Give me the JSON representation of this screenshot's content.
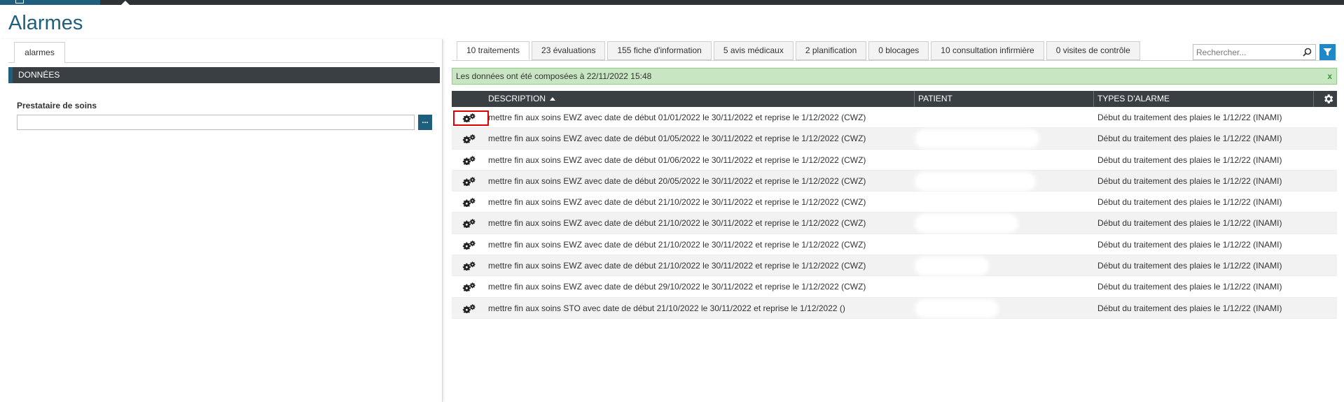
{
  "page": {
    "title": "Alarmes"
  },
  "left": {
    "tab_label": "alarmes",
    "section_title": "DONNÉES",
    "field_label": "Prestataire de soins",
    "field_value": "",
    "field_button": "..."
  },
  "tabs": [
    {
      "label": "10 traitements",
      "active": true
    },
    {
      "label": "23 évaluations",
      "active": false
    },
    {
      "label": "155 fiche d'information",
      "active": false
    },
    {
      "label": "5 avis médicaux",
      "active": false
    },
    {
      "label": "2 planification",
      "active": false
    },
    {
      "label": "0 blocages",
      "active": false
    },
    {
      "label": "10 consultation infirmière",
      "active": false
    },
    {
      "label": "0 visites de contrôle",
      "active": false
    }
  ],
  "search": {
    "placeholder": "Rechercher..."
  },
  "banner": {
    "text": "Les données ont été composées à 22/11/2022 15:48",
    "close": "x"
  },
  "grid": {
    "columns": {
      "description": "DESCRIPTION",
      "patient": "PATIENT",
      "types": "TYPES D'ALARME"
    },
    "rows": [
      {
        "description": "mettre fin aux soins EWZ avec date de début 01/01/2022 le 30/11/2022 et reprise le 1/12/2022 (CWZ)",
        "patient": "",
        "type": "Début du traitement des plaies le 1/12/22 (INAMI)"
      },
      {
        "description": "mettre fin aux soins EWZ avec date de début 01/05/2022 le 30/11/2022 et reprise le 1/12/2022 (CWZ)",
        "patient": "",
        "type": "Début du traitement des plaies le 1/12/22 (INAMI)"
      },
      {
        "description": "mettre fin aux soins EWZ avec date de début 01/06/2022 le 30/11/2022 et reprise le 1/12/2022 (CWZ)",
        "patient": "",
        "type": "Début du traitement des plaies le 1/12/22 (INAMI)"
      },
      {
        "description": "mettre fin aux soins EWZ avec date de début 20/05/2022 le 30/11/2022 et reprise le 1/12/2022 (CWZ)",
        "patient": "",
        "type": "Début du traitement des plaies le 1/12/22 (INAMI)"
      },
      {
        "description": "mettre fin aux soins EWZ avec date de début 21/10/2022 le 30/11/2022 et reprise le 1/12/2022 (CWZ)",
        "patient": "",
        "type": "Début du traitement des plaies le 1/12/22 (INAMI)"
      },
      {
        "description": "mettre fin aux soins EWZ avec date de début 21/10/2022 le 30/11/2022 et reprise le 1/12/2022 (CWZ)",
        "patient": "",
        "type": "Début du traitement des plaies le 1/12/22 (INAMI)"
      },
      {
        "description": "mettre fin aux soins EWZ avec date de début 21/10/2022 le 30/11/2022 et reprise le 1/12/2022 (CWZ)",
        "patient": "",
        "type": "Début du traitement des plaies le 1/12/22 (INAMI)"
      },
      {
        "description": "mettre fin aux soins EWZ avec date de début 21/10/2022 le 30/11/2022 et reprise le 1/12/2022 (CWZ)",
        "patient": "",
        "type": "Début du traitement des plaies le 1/12/22 (INAMI)"
      },
      {
        "description": "mettre fin aux soins EWZ avec date de début 29/10/2022 le 30/11/2022 et reprise le 1/12/2022 (CWZ)",
        "patient": "",
        "type": "Début du traitement des plaies le 1/12/22 (INAMI)"
      },
      {
        "description": "mettre fin aux soins STO avec date de début 21/10/2022 le 30/11/2022 et reprise le 1/12/2022 ()",
        "patient": "",
        "type": "Début du traitement des plaies le 1/12/22 (INAMI)"
      }
    ]
  },
  "colors": {
    "accent": "#1f5f7e",
    "header_bg": "#3a3f44",
    "banner_bg": "#c8e6c2",
    "highlight": "#e00000",
    "filter_btn": "#1e88c9"
  },
  "icons": {
    "row_action": "gears-icon",
    "grid_settings": "gear-icon",
    "search": "search-icon",
    "filter": "filter-icon",
    "home": "home-icon"
  }
}
